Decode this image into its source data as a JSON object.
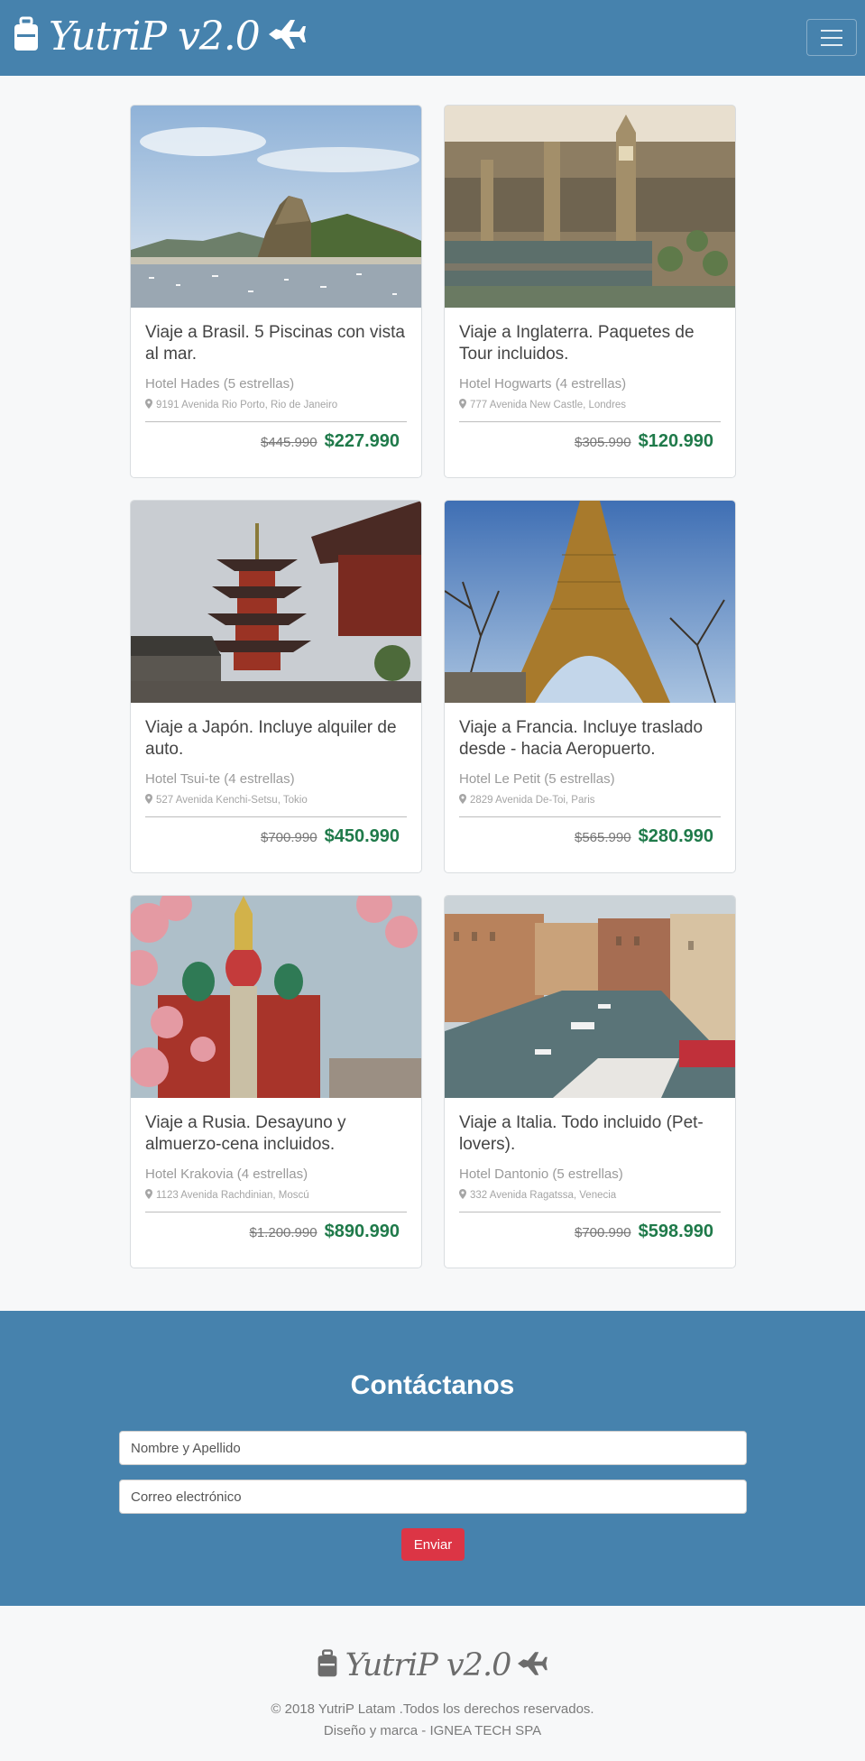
{
  "navbar": {
    "brand": "YutriP v2.0",
    "brand_icon": "suitcase-icon",
    "plane_icon": "airplane-icon",
    "menu_icon": "hamburger-menu-icon"
  },
  "cards": [
    {
      "title": "Viaje a Brasil. 5 Piscinas con vista al mar.",
      "hotel": "Hotel Hades (5 estrellas)",
      "address": "9191 Avenida Rio Porto, Rio de Janeiro",
      "old_price": "$445.990",
      "new_price": "$227.990"
    },
    {
      "title": "Viaje a Inglaterra. Paquetes de Tour incluidos.",
      "hotel": "Hotel Hogwarts (4 estrellas)",
      "address": "777 Avenida New Castle, Londres",
      "old_price": "$305.990",
      "new_price": "$120.990"
    },
    {
      "title": "Viaje a Japón. Incluye alquiler de auto.",
      "hotel": "Hotel Tsui-te (4 estrellas)",
      "address": "527 Avenida Kenchi-Setsu, Tokio",
      "old_price": "$700.990",
      "new_price": "$450.990"
    },
    {
      "title": "Viaje a Francia. Incluye traslado desde - hacia Aeropuerto.",
      "hotel": "Hotel Le Petit (5 estrellas)",
      "address": "2829 Avenida De-Toi, Paris",
      "old_price": "$565.990",
      "new_price": "$280.990"
    },
    {
      "title": "Viaje a Rusia. Desayuno y almuerzo-cena incluidos.",
      "hotel": "Hotel Krakovia (4 estrellas)",
      "address": "1123 Avenida Rachdinian, Moscú",
      "old_price": "$1.200.990",
      "new_price": "$890.990"
    },
    {
      "title": "Viaje a Italia. Todo incluido (Pet-lovers).",
      "hotel": "Hotel Dantonio (5 estrellas)",
      "address": "332 Avenida Ragatssa, Venecia",
      "old_price": "$700.990",
      "new_price": "$598.990"
    }
  ],
  "contact": {
    "title": "Contáctanos",
    "name_placeholder": "Nombre y Apellido",
    "email_placeholder": "Correo electrónico",
    "submit_label": "Enviar"
  },
  "footer": {
    "brand": "YutriP v2.0",
    "copyright": "© 2018 YutriP Latam .Todos los derechos reservados.",
    "credits": "Diseño y marca - IGNEA TECH SPA"
  },
  "colors": {
    "primary": "#4682ad",
    "price_green": "#1f7a4a",
    "button_red": "#dc3545"
  }
}
